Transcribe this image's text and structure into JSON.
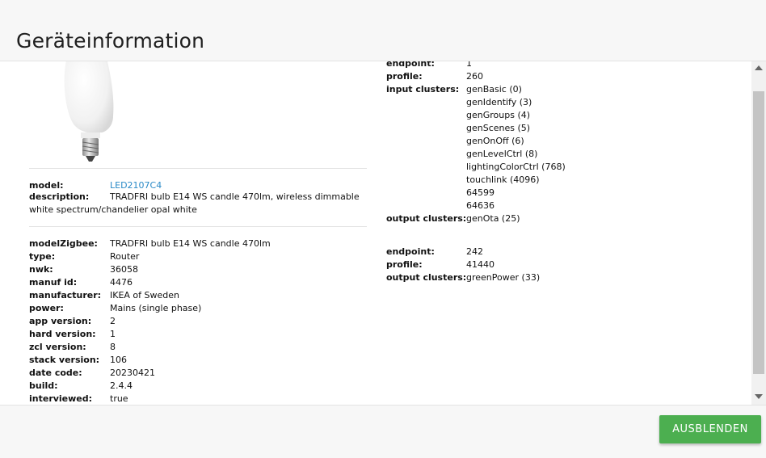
{
  "dialog": {
    "title": "Geräteinformation"
  },
  "device": {
    "model_label": "model:",
    "model_value": "LED2107C4",
    "description_label": "description:",
    "description_value": "TRADFRI bulb E14 WS candle 470lm, wireless dimmable white spectrum/chandelier opal white",
    "details": [
      {
        "key": "modelZigbee:",
        "value": "TRADFRI bulb E14 WS candle 470lm"
      },
      {
        "key": "type:",
        "value": "Router"
      },
      {
        "key": "nwk:",
        "value": "36058"
      },
      {
        "key": "manuf id:",
        "value": "4476"
      },
      {
        "key": "manufacturer:",
        "value": "IKEA of Sweden"
      },
      {
        "key": "power:",
        "value": "Mains (single phase)"
      },
      {
        "key": "app version:",
        "value": "2"
      },
      {
        "key": "hard version:",
        "value": "1"
      },
      {
        "key": "zcl version:",
        "value": "8"
      },
      {
        "key": "stack version:",
        "value": "106"
      },
      {
        "key": "date code:",
        "value": "20230421"
      },
      {
        "key": "build:",
        "value": "2.4.4"
      },
      {
        "key": "interviewed:",
        "value": "true"
      }
    ]
  },
  "endpoints": [
    {
      "endpoint_label": "endpoint:",
      "endpoint": "1",
      "profile_label": "profile:",
      "profile": "260",
      "input_label": "input clusters:",
      "input_clusters": [
        "genBasic (0)",
        "genIdentify (3)",
        "genGroups (4)",
        "genScenes (5)",
        "genOnOff (6)",
        "genLevelCtrl (8)",
        "lightingColorCtrl (768)",
        "touchlink (4096)",
        "64599",
        "64636"
      ],
      "output_label": "output clusters:",
      "output_clusters": [
        "genOta (25)"
      ]
    },
    {
      "endpoint_label": "endpoint:",
      "endpoint": "242",
      "profile_label": "profile:",
      "profile": "41440",
      "output_label": "output clusters:",
      "output_clusters": [
        "greenPower (33)"
      ]
    }
  ],
  "footer": {
    "hide_button": "AUSBLENDEN"
  },
  "colors": {
    "button": "#4caf50",
    "link": "#2a8ac7"
  }
}
